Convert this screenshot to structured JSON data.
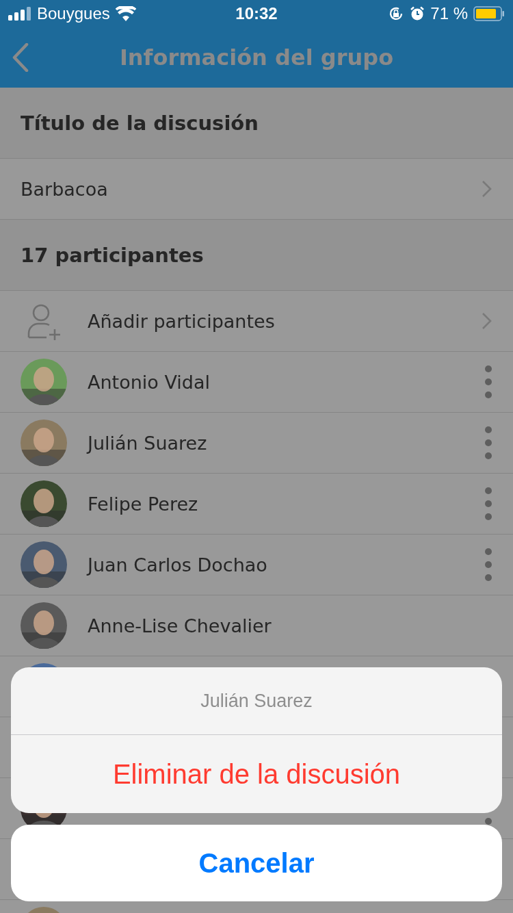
{
  "status_bar": {
    "carrier": "Bouygues",
    "time": "10:32",
    "battery": "71 %"
  },
  "nav": {
    "title": "Información del grupo"
  },
  "title_section": {
    "header": "Título de la discusión",
    "value": "Barbacoa"
  },
  "participants_section": {
    "header": "17 participantes",
    "add_label": "Añadir participantes",
    "members": [
      {
        "kind": "person",
        "name": "Antonio Vidal",
        "menu": true
      },
      {
        "kind": "person",
        "name": "Julián Suarez",
        "menu": true
      },
      {
        "kind": "person",
        "name": "Felipe Perez",
        "menu": true
      },
      {
        "kind": "person",
        "name": "Juan Carlos Dochao",
        "menu": true
      },
      {
        "kind": "person",
        "name": "Anne-Lise Chevalier",
        "menu": false
      },
      {
        "kind": "person",
        "menu": false
      },
      {
        "kind": "covered"
      },
      {
        "kind": "person",
        "menu": true
      },
      {
        "kind": "covered"
      },
      {
        "kind": "person",
        "menu": false
      }
    ]
  },
  "action_sheet": {
    "title": "Julián Suarez",
    "actions": [
      {
        "label": "Eliminar de la discusión",
        "kind": "destructive"
      }
    ],
    "cancel": "Cancelar"
  }
}
